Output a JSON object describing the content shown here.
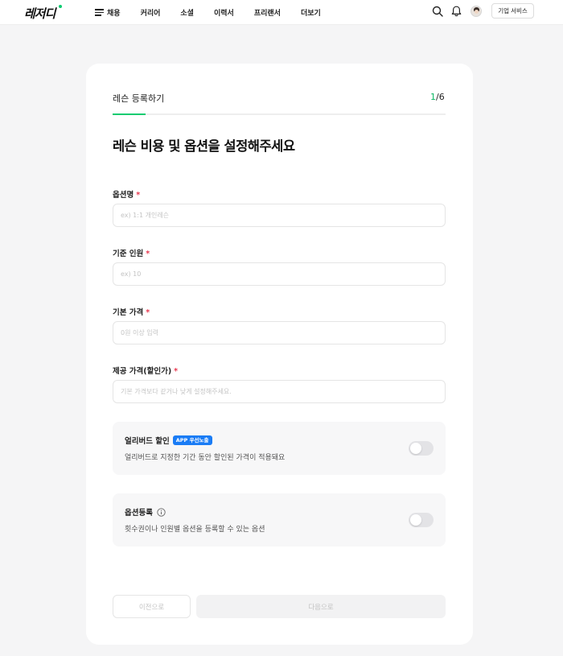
{
  "header": {
    "logo": "레저디",
    "nav": [
      {
        "label": "채용",
        "name": "nav-recruit"
      },
      {
        "label": "커리어",
        "name": "nav-career"
      },
      {
        "label": "소셜",
        "name": "nav-social"
      },
      {
        "label": "이력서",
        "name": "nav-resume"
      },
      {
        "label": "프리랜서",
        "name": "nav-freelancer"
      },
      {
        "label": "더보기",
        "name": "nav-more"
      }
    ],
    "corp_button": "기업 서비스"
  },
  "form": {
    "title": "레슨 등록하기",
    "step_current": "1",
    "step_total": "/6",
    "progress": 0.1,
    "heading": "레슨 비용 및 옵션을 설정해주세요",
    "fields": {
      "option_name": {
        "label": "옵션명",
        "placeholder": "ex) 1:1 개인레슨",
        "value": ""
      },
      "base_people": {
        "label": "기준 인원",
        "placeholder": "ex) 10",
        "value": ""
      },
      "base_price": {
        "label": "기본 가격",
        "placeholder": "0원 이상 입력",
        "value": ""
      },
      "offer_price": {
        "label": "제공 가격(할인가)",
        "placeholder": "기본 가격보다 같거나 낮게 설정해주세요.",
        "value": ""
      }
    },
    "required_mark": "*",
    "early_bird": {
      "title": "얼리버드 할인",
      "badge": "APP 우선노출",
      "desc": "얼리버드로 지정한 기간 동안 할인된 가격이 적용돼요",
      "on": false
    },
    "option_register": {
      "title": "옵션등록",
      "desc": "횟수권이나 인원별 옵션을 등록할 수 있는 옵션",
      "on": false
    },
    "prev_button": "이전으로",
    "next_button": "다음으로"
  },
  "colors": {
    "accent": "#0bcb70",
    "required": "#e8384f",
    "badge": "#1a7cf5",
    "background": "#f5f5f6"
  }
}
